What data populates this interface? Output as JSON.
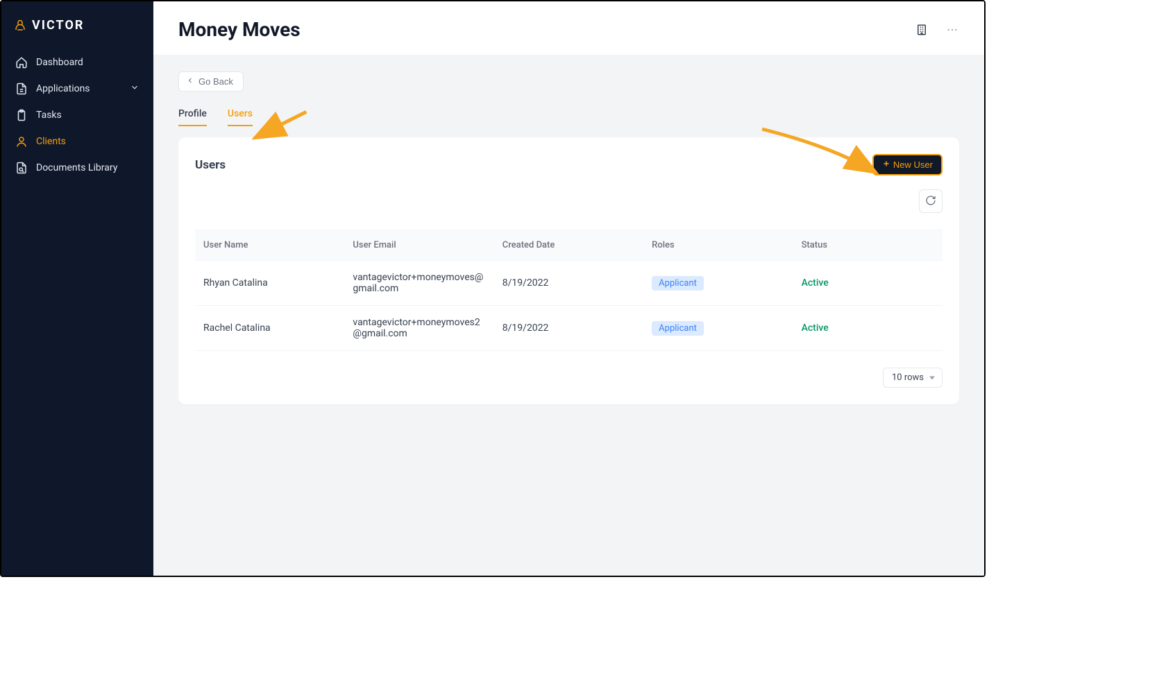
{
  "brand": {
    "name": "VICTOR"
  },
  "sidebar": {
    "items": [
      {
        "label": "Dashboard",
        "icon": "home",
        "active": false,
        "expandable": false
      },
      {
        "label": "Applications",
        "icon": "file",
        "active": false,
        "expandable": true
      },
      {
        "label": "Tasks",
        "icon": "clipboard",
        "active": false,
        "expandable": false
      },
      {
        "label": "Clients",
        "icon": "user",
        "active": true,
        "expandable": false
      },
      {
        "label": "Documents Library",
        "icon": "doc-search",
        "active": false,
        "expandable": false
      }
    ]
  },
  "header": {
    "title": "Money Moves"
  },
  "content": {
    "go_back_label": "Go Back",
    "tabs": [
      {
        "label": "Profile",
        "active": false
      },
      {
        "label": "Users",
        "active": true
      }
    ],
    "panel": {
      "title": "Users",
      "new_user_label": "New User",
      "columns": [
        "User Name",
        "User Email",
        "Created Date",
        "Roles",
        "Status"
      ],
      "rows": [
        {
          "name": "Rhyan Catalina",
          "email": "vantagevictor+moneymoves@gmail.com",
          "created": "8/19/2022",
          "role": "Applicant",
          "status": "Active"
        },
        {
          "name": "Rachel Catalina",
          "email": "vantagevictor+moneymoves2@gmail.com",
          "created": "8/19/2022",
          "role": "Applicant",
          "status": "Active"
        }
      ],
      "rows_select_label": "10 rows"
    }
  },
  "colors": {
    "accent": "#f59e0b",
    "sidebar_bg": "#0f172a",
    "role_chip_bg": "#dbeafe",
    "role_chip_text": "#3b82f6",
    "status_active": "#059669"
  }
}
